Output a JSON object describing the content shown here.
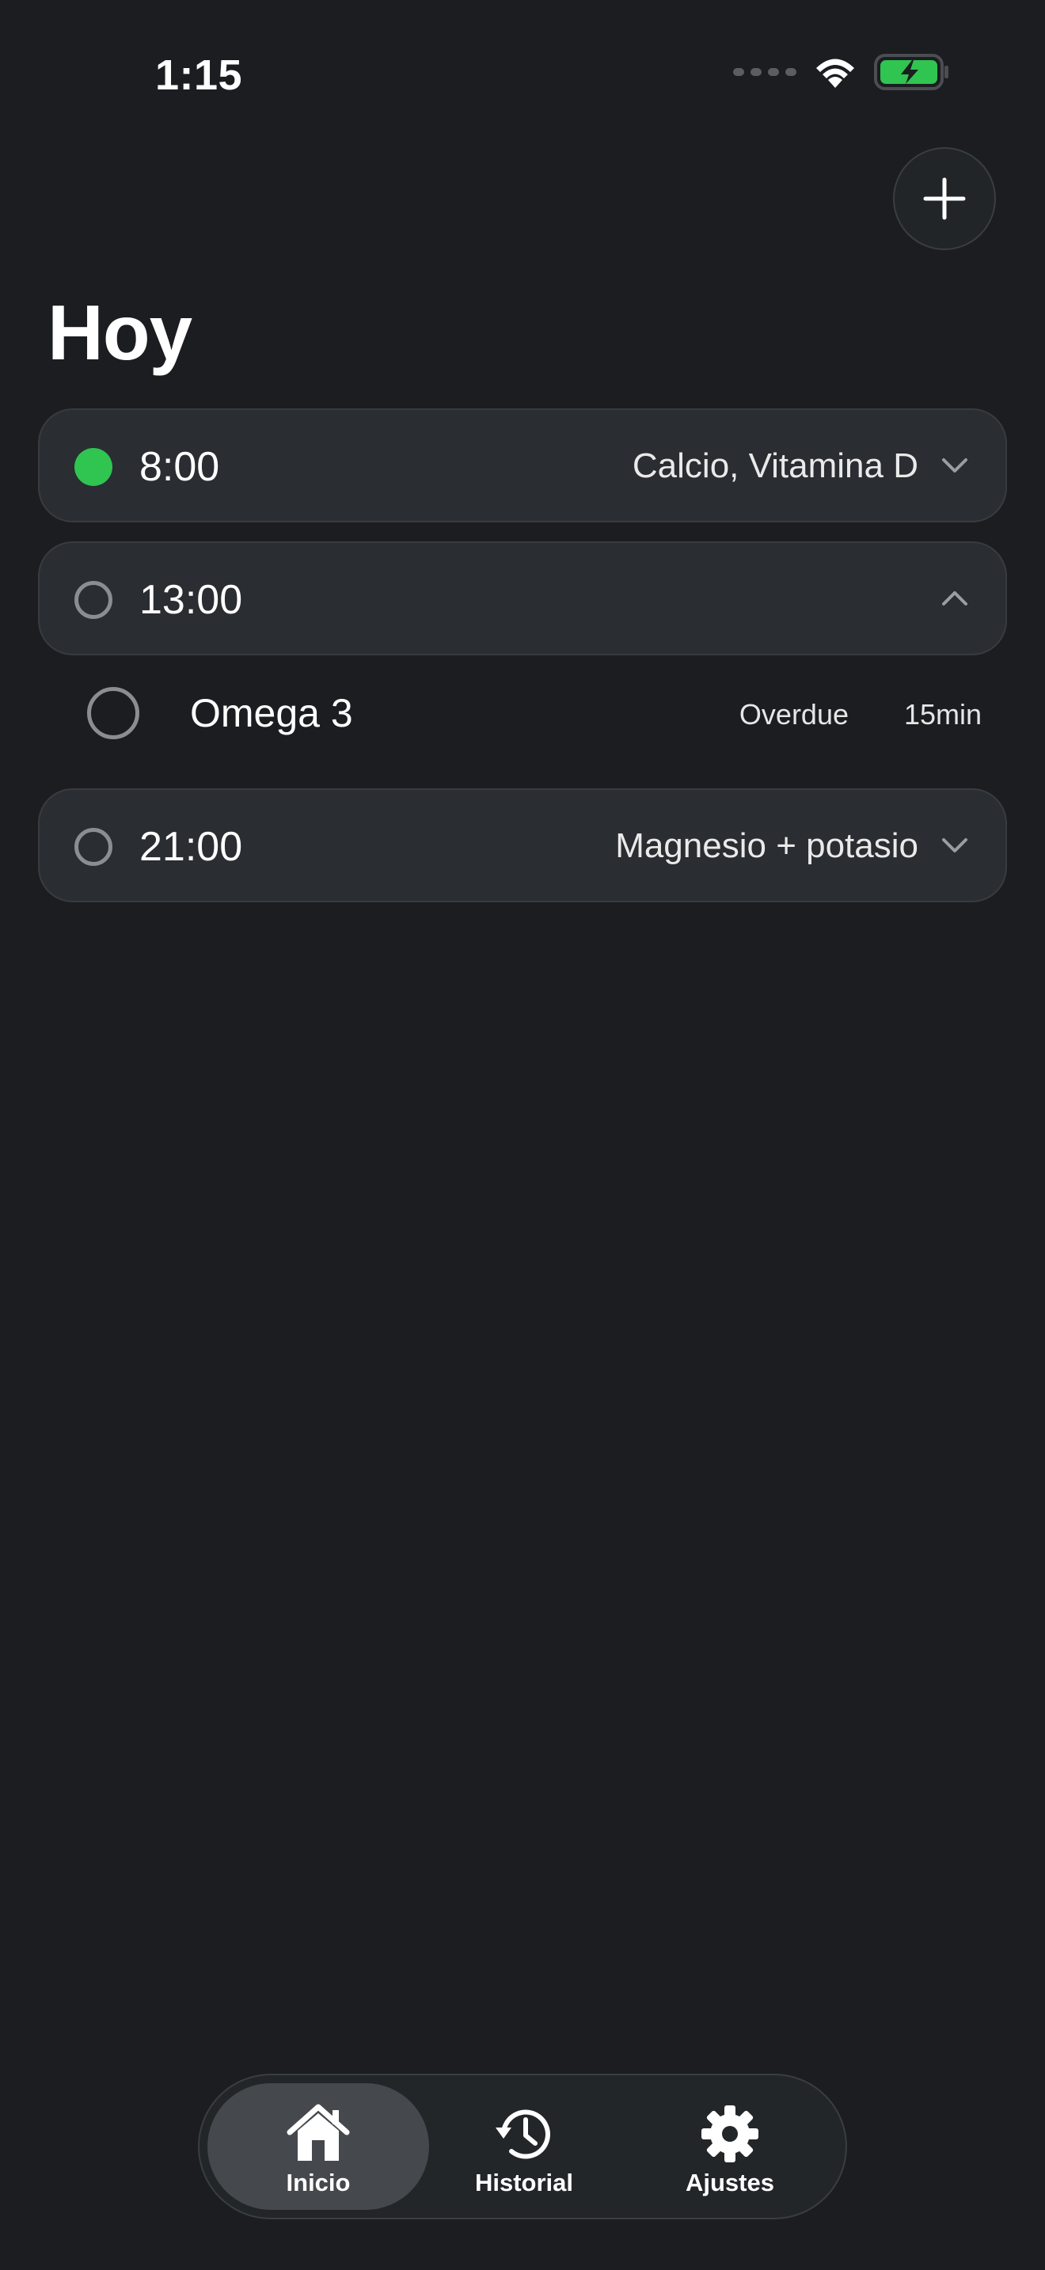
{
  "status_bar": {
    "time": "1:15"
  },
  "header": {
    "title": "Hoy",
    "add_icon": "plus-icon"
  },
  "schedule": [
    {
      "time": "8:00",
      "summary": "Calcio, Vitamina D",
      "status": "done",
      "expanded": false
    },
    {
      "time": "13:00",
      "summary": "",
      "status": "pending",
      "expanded": true,
      "items": [
        {
          "name": "Omega 3",
          "status": "Overdue",
          "delay": "15min"
        }
      ]
    },
    {
      "time": "21:00",
      "summary": "Magnesio + potasio",
      "status": "pending",
      "expanded": false
    }
  ],
  "tabs": [
    {
      "label": "Inicio",
      "icon": "house-icon",
      "active": true
    },
    {
      "label": "Historial",
      "icon": "history-icon",
      "active": false
    },
    {
      "label": "Ajustes",
      "icon": "gear-icon",
      "active": false
    }
  ],
  "colors": {
    "background": "#1b1d20",
    "card": "#2a2d31",
    "done": "#30c451",
    "battery": "#30c451"
  }
}
